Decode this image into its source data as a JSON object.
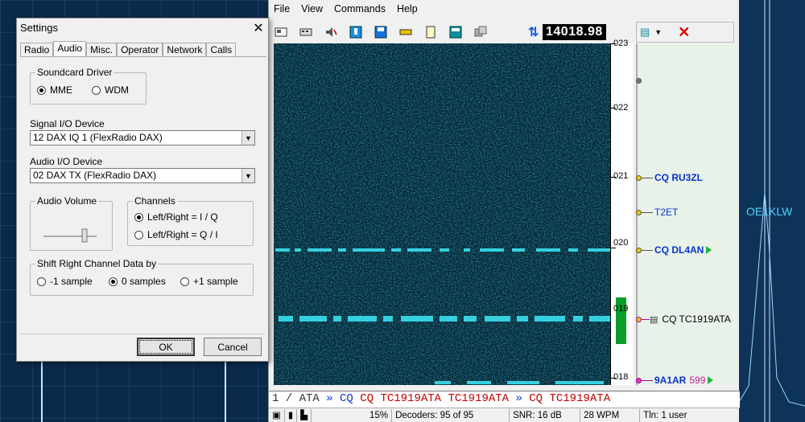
{
  "background": {
    "right_label": "OE1KLW"
  },
  "app": {
    "menu": [
      "File",
      "View",
      "Commands",
      "Help"
    ],
    "frequency": "14018.98",
    "freq_scale": [
      "023",
      "022",
      "021",
      "020",
      "019",
      "018"
    ],
    "spots": [
      {
        "call": "CQ RU3ZL",
        "style": "bold",
        "marker": "dot"
      },
      {
        "call": "T2ET",
        "style": "plain",
        "marker": "dot"
      },
      {
        "call": "CQ DL4AN",
        "style": "bold",
        "marker": "dot",
        "tri": true
      },
      {
        "call": "CQ TC1919ATA",
        "style": "black",
        "marker": "dot-doc"
      },
      {
        "call": "9A1AR",
        "extra": "599",
        "style": "bold",
        "marker": "dot-pink",
        "tri": true
      }
    ],
    "decoded_text": {
      "prefix": "1 / ATA ",
      "arrow": "»",
      "seg1": " CQ  TC1919ATA  TC1919ATA ",
      "seg2": " CQ  TC1919ATA"
    },
    "status": {
      "percent": "15%",
      "decoders": "Decoders: 95 of 95",
      "snr": "SNR: 16 dB",
      "wpm": "28 WPM",
      "tln": "Tln: 1 user"
    }
  },
  "settings": {
    "title": "Settings",
    "tabs": [
      "Radio",
      "Audio",
      "Misc.",
      "Operator",
      "Network",
      "Calls"
    ],
    "active_tab": "Audio",
    "soundcard_driver": {
      "label": "Soundcard Driver",
      "options": [
        "MME",
        "WDM"
      ],
      "selected": "MME"
    },
    "signal_io": {
      "label": "Signal I/O Device",
      "value": "12  DAX IQ 1 (FlexRadio DAX)"
    },
    "audio_io": {
      "label": "Audio I/O Device",
      "value": "02  DAX TX (FlexRadio DAX)"
    },
    "audio_volume": {
      "label": "Audio Volume"
    },
    "channels": {
      "label": "Channels",
      "options": [
        "Left/Right = I / Q",
        "Left/Right = Q / I"
      ],
      "selected": "Left/Right = I / Q"
    },
    "shift": {
      "label": "Shift Right Channel Data by",
      "options": [
        "-1 sample",
        "0 samples",
        "+1 sample"
      ],
      "selected": "0 samples"
    },
    "ok_label": "OK",
    "cancel_label": "Cancel"
  },
  "colors": {
    "accent": "#0a32c8",
    "waterfall": "#072a3a",
    "signal": "#35d0e0",
    "freq_bg": "#000000"
  }
}
